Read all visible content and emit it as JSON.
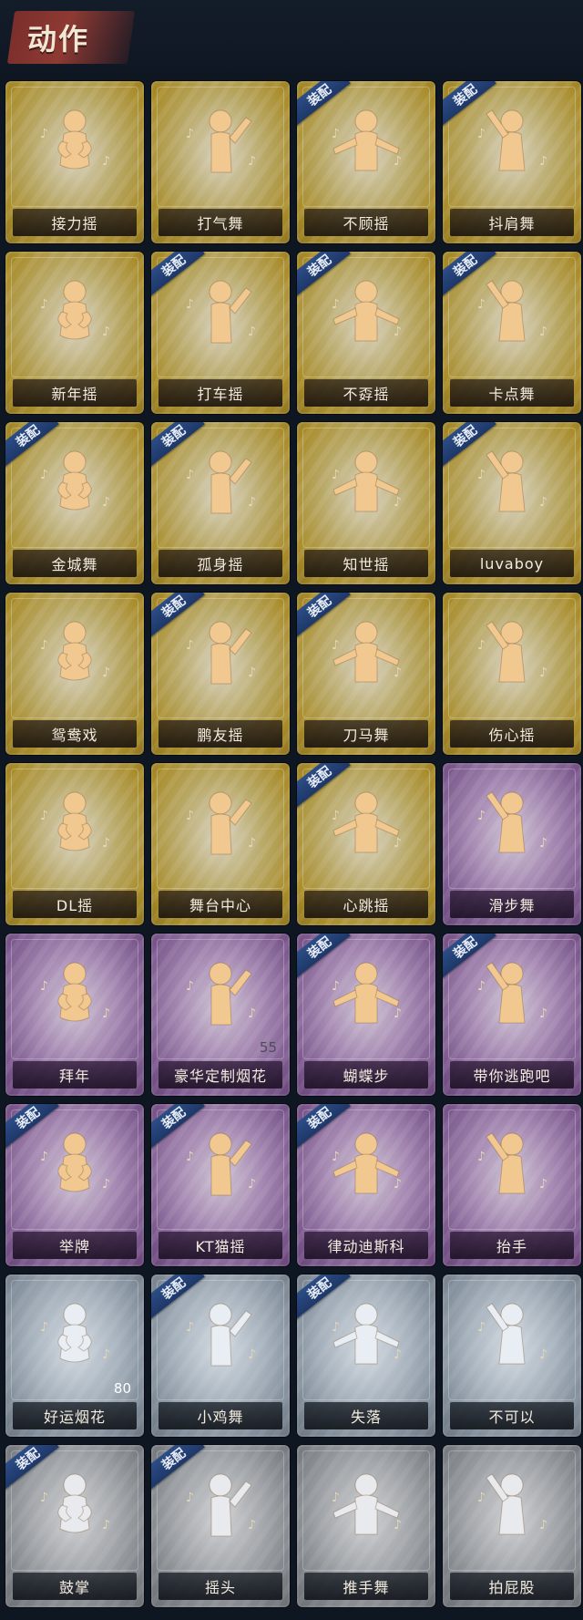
{
  "header": {
    "title": "动作"
  },
  "equip_tag_label": "装配",
  "colors": {
    "gold": "#a98d2c",
    "purple": "#7c5a8e",
    "silver": "#7f8b97",
    "gray": "#7d8186",
    "equip_tag": "#2c4d86",
    "background": "#0e1622"
  },
  "cards": [
    {
      "label": "接力摇",
      "rarity": "gold",
      "equipped": false,
      "icon": "dancer-hands-chest-icon"
    },
    {
      "label": "打气舞",
      "rarity": "gold",
      "equipped": false,
      "icon": "dancer-fist-music-icon"
    },
    {
      "label": "不顾摇",
      "rarity": "gold",
      "equipped": true,
      "icon": "dancer-point-icon"
    },
    {
      "label": "抖肩舞",
      "rarity": "gold",
      "equipped": true,
      "icon": "dancer-shoulder-icon"
    },
    {
      "label": "新年摇",
      "rarity": "gold",
      "equipped": false,
      "icon": "dancer-arms-crossed-icon"
    },
    {
      "label": "打车摇",
      "rarity": "gold",
      "equipped": true,
      "icon": "dancer-bend-icon"
    },
    {
      "label": "不孬摇",
      "rarity": "gold",
      "equipped": true,
      "icon": "dancer-arm-up-icon"
    },
    {
      "label": "卡点舞",
      "rarity": "gold",
      "equipped": true,
      "icon": "dancer-dab-icon"
    },
    {
      "label": "金城舞",
      "rarity": "gold",
      "equipped": true,
      "icon": "dancer-wave-icon"
    },
    {
      "label": "孤身摇",
      "rarity": "gold",
      "equipped": true,
      "icon": "dancer-arms-out-icon"
    },
    {
      "label": "知世摇",
      "rarity": "gold",
      "equipped": false,
      "icon": "dancer-clap-icon"
    },
    {
      "label": "luvaboy",
      "rarity": "gold",
      "equipped": true,
      "icon": "dancer-lean-icon"
    },
    {
      "label": "鸳鸯戏",
      "rarity": "gold",
      "equipped": false,
      "icon": "dancer-hands-side-icon"
    },
    {
      "label": "鹏友摇",
      "rarity": "gold",
      "equipped": true,
      "icon": "dancer-arm-sweep-icon"
    },
    {
      "label": "刀马舞",
      "rarity": "gold",
      "equipped": true,
      "icon": "dancer-pose-icon"
    },
    {
      "label": "伤心摇",
      "rarity": "gold",
      "equipped": false,
      "icon": "dancer-heart-hands-icon"
    },
    {
      "label": "DL摇",
      "rarity": "gold",
      "equipped": false,
      "icon": "dancer-point-up-icon"
    },
    {
      "label": "舞台中心",
      "rarity": "gold",
      "equipped": false,
      "icon": "dancer-center-icon"
    },
    {
      "label": "心跳摇",
      "rarity": "gold",
      "equipped": true,
      "icon": "dancer-hand-raise-icon"
    },
    {
      "label": "滑步舞",
      "rarity": "purple",
      "equipped": false,
      "icon": "dancer-slide-icon"
    },
    {
      "label": "拜年",
      "rarity": "purple",
      "equipped": false,
      "icon": "bow-greeting-icon"
    },
    {
      "label": "豪华定制烟花",
      "rarity": "purple",
      "equipped": false,
      "icon": "fireworks-box-icon",
      "count": "55"
    },
    {
      "label": "蝴蝶步",
      "rarity": "purple",
      "equipped": true,
      "icon": "dancer-butterfly-icon"
    },
    {
      "label": "带你逃跑吧",
      "rarity": "purple",
      "equipped": true,
      "icon": "dancer-run-icon"
    },
    {
      "label": "举牌",
      "rarity": "purple",
      "equipped": true,
      "icon": "hold-sign-icon"
    },
    {
      "label": "KT猫摇",
      "rarity": "purple",
      "equipped": true,
      "icon": "dancer-cat-icon"
    },
    {
      "label": "律动迪斯科",
      "rarity": "purple",
      "equipped": true,
      "icon": "dancer-disco-icon"
    },
    {
      "label": "抬手",
      "rarity": "purple",
      "equipped": false,
      "icon": "raise-hand-icon"
    },
    {
      "label": "好运烟花",
      "rarity": "silver",
      "equipped": false,
      "icon": "firecracker-icon",
      "count": "80"
    },
    {
      "label": "小鸡舞",
      "rarity": "silver",
      "equipped": true,
      "icon": "chicken-dance-icon"
    },
    {
      "label": "失落",
      "rarity": "silver",
      "equipped": true,
      "icon": "crawl-icon"
    },
    {
      "label": "不可以",
      "rarity": "silver",
      "equipped": false,
      "icon": "finger-wag-icon"
    },
    {
      "label": "鼓掌",
      "rarity": "gray",
      "equipped": true,
      "icon": "clap-hands-icon"
    },
    {
      "label": "摇头",
      "rarity": "gray",
      "equipped": true,
      "icon": "shake-head-icon"
    },
    {
      "label": "推手舞",
      "rarity": "gray",
      "equipped": false,
      "icon": "push-hands-icon"
    },
    {
      "label": "拍屁股",
      "rarity": "gray",
      "equipped": false,
      "icon": "spank-icon"
    }
  ]
}
